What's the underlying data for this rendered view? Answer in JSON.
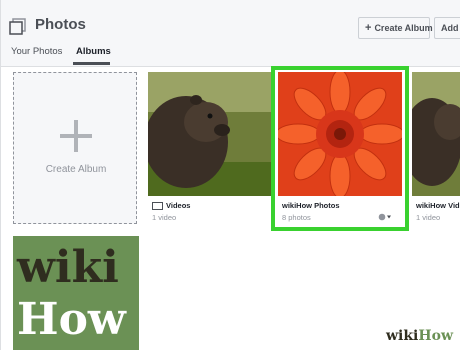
{
  "header": {
    "title": "Photos",
    "create_album_label": "Create Album",
    "add_label": "Add P"
  },
  "tabs": [
    {
      "label": "Your Photos",
      "active": false
    },
    {
      "label": "Albums",
      "active": true
    }
  ],
  "create_card": {
    "label": "Create Album"
  },
  "albums": [
    {
      "name": "Videos",
      "count": "1 video",
      "icon": "video-icon"
    },
    {
      "name": "wikiHow Photos",
      "count": "8 photos",
      "icon": "globe-icon",
      "highlighted": true
    },
    {
      "name": "wikiHow Vide",
      "count": "1 video"
    }
  ],
  "wikihow_card": {
    "top": "wiki",
    "bottom": "How"
  },
  "watermark": {
    "part1": "wiki",
    "part2": "How"
  },
  "colors": {
    "highlight": "#39d12f",
    "wikihow_green": "#6b9155"
  }
}
